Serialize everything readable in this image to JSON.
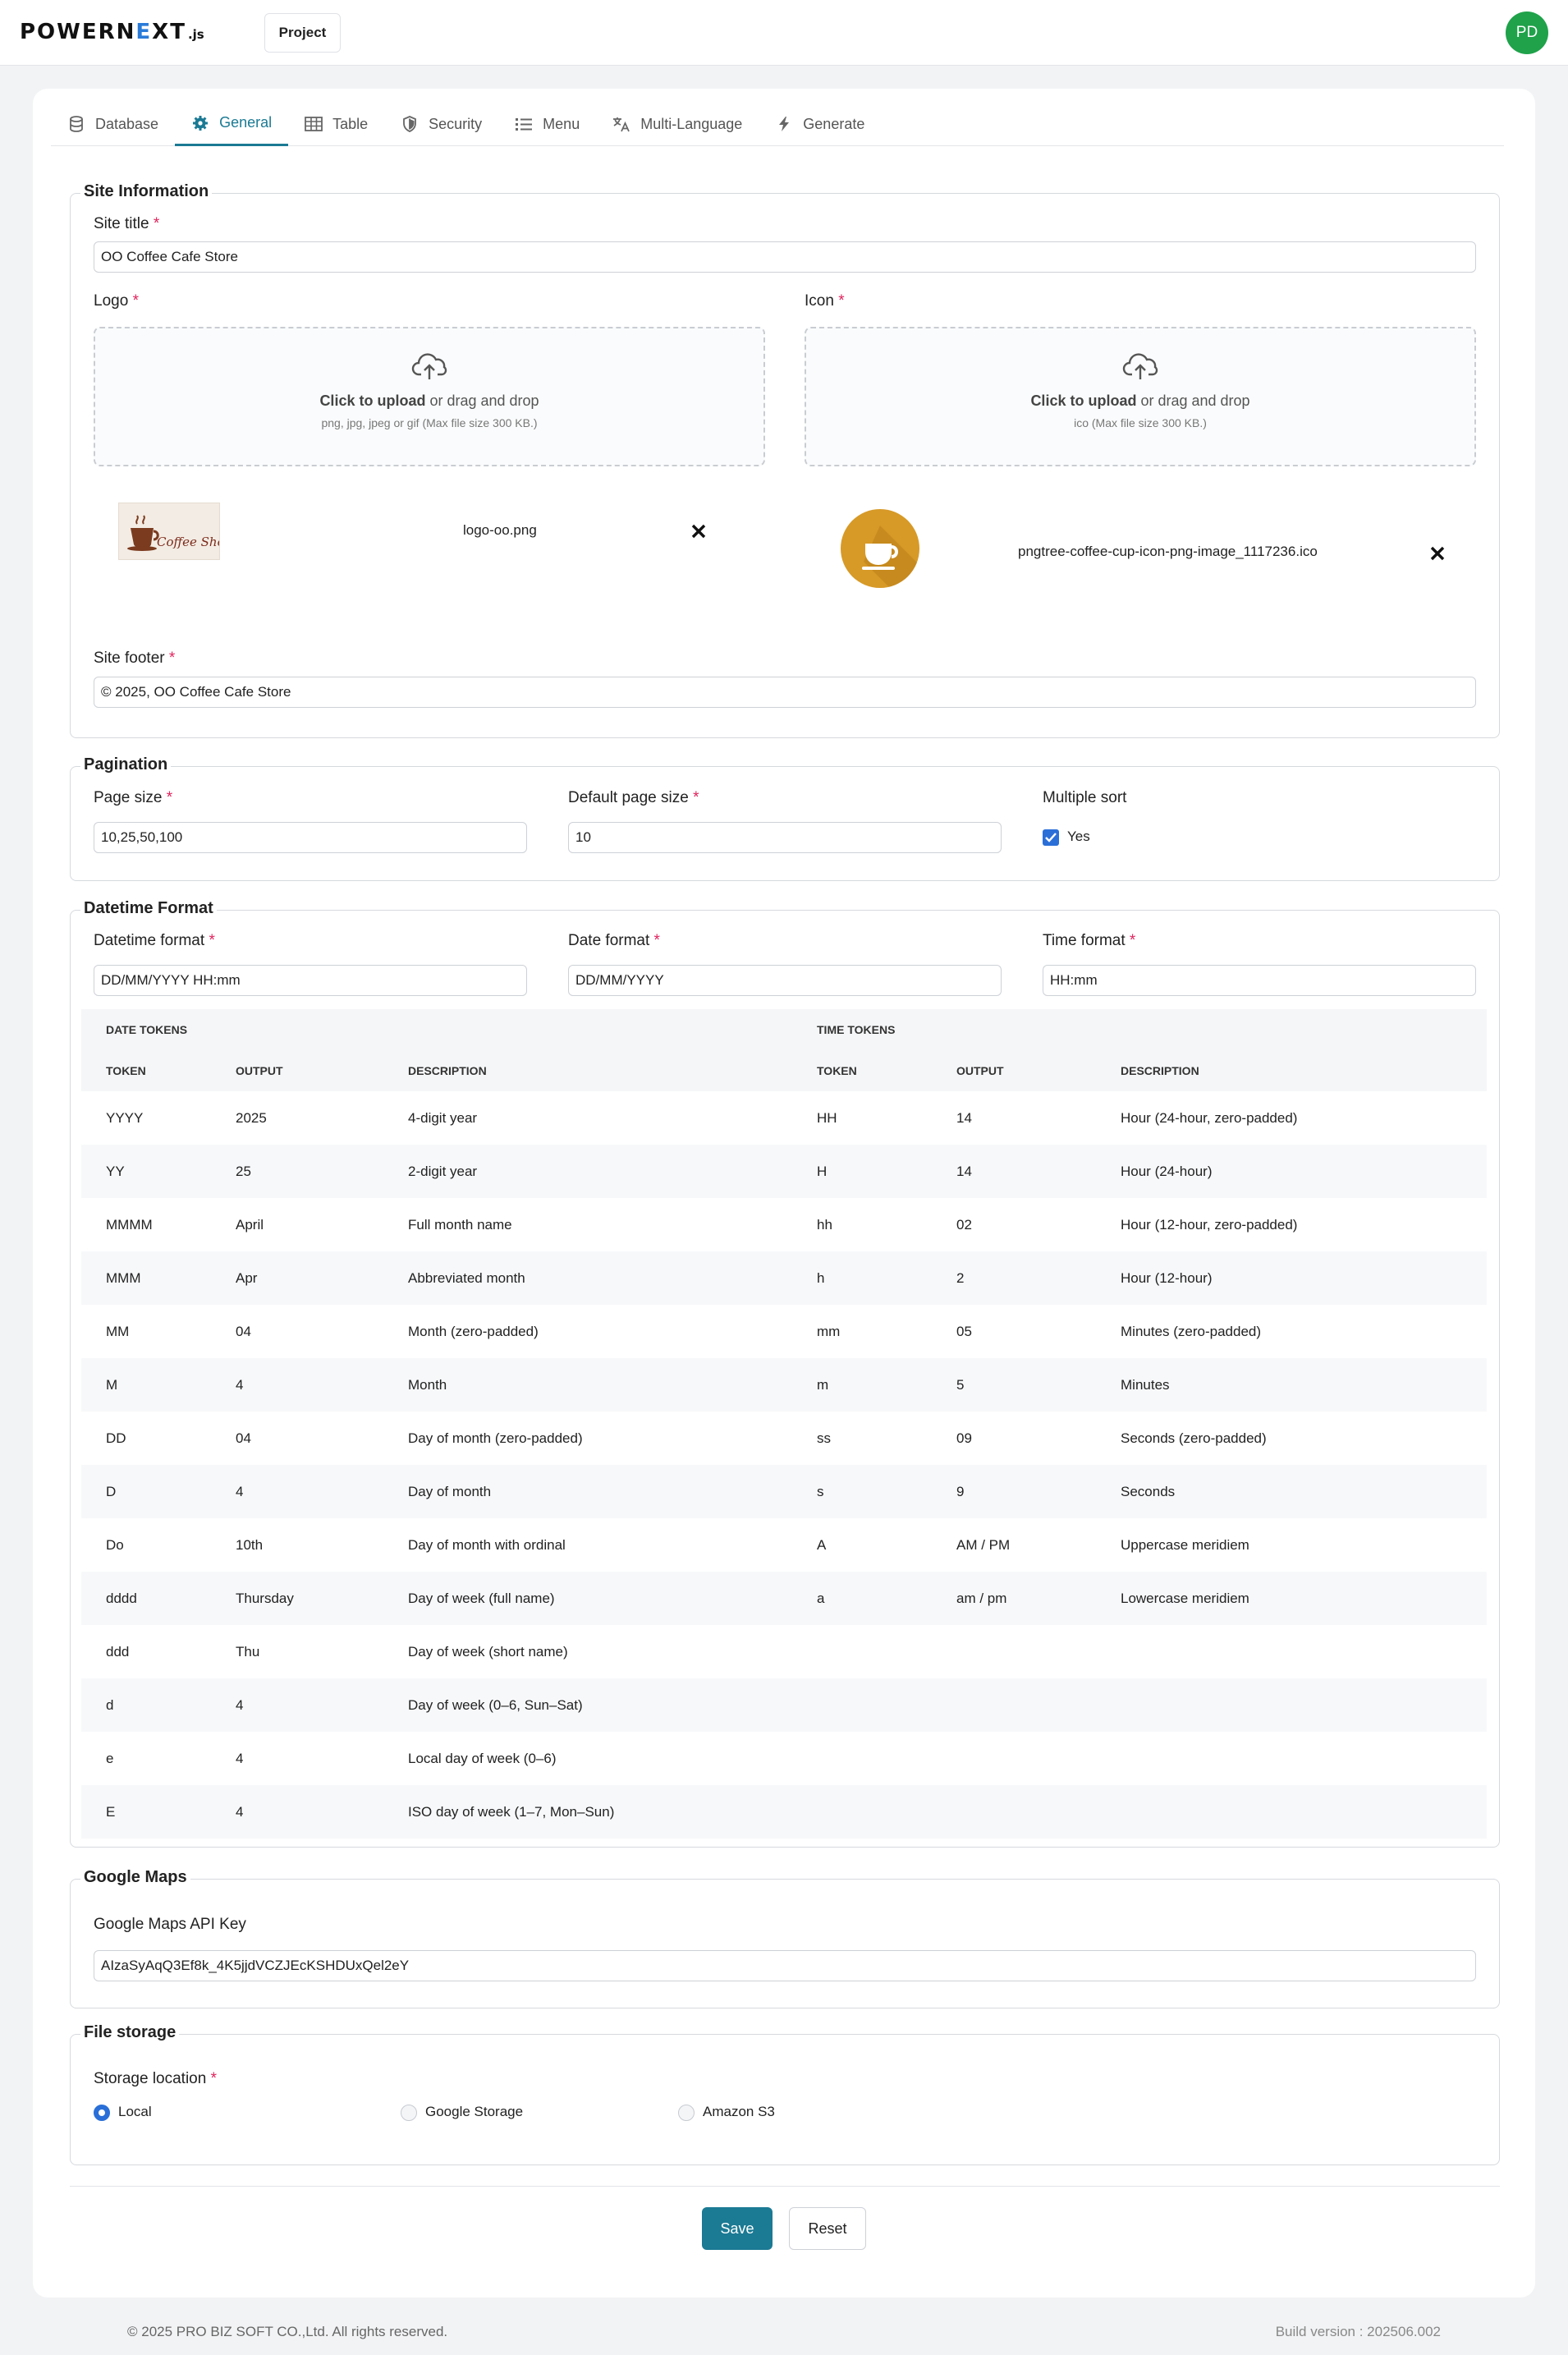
{
  "header": {
    "brand_prefix": "POWERN",
    "brand_highlight": "E",
    "brand_suffix": "XT",
    "brand_js": ".js",
    "project_label": "Project",
    "avatar_initials": "PD"
  },
  "tabs": [
    {
      "label": "Database",
      "icon": "database-icon"
    },
    {
      "label": "General",
      "icon": "gear-icon",
      "active": true
    },
    {
      "label": "Table",
      "icon": "table-icon"
    },
    {
      "label": "Security",
      "icon": "shield-icon"
    },
    {
      "label": "Menu",
      "icon": "list-icon"
    },
    {
      "label": "Multi-Language",
      "icon": "translate-icon"
    },
    {
      "label": "Generate",
      "icon": "lightning-icon"
    }
  ],
  "site_info": {
    "legend": "Site Information",
    "title_label": "Site title",
    "title_value": "OO Coffee Cafe Store",
    "logo_label": "Logo",
    "icon_label": "Icon",
    "upload_click": "Click to upload",
    "upload_rest": " or drag and drop",
    "logo_hint": "png, jpg, jpeg or gif (Max file size 300 KB.)",
    "icon_hint": "ico (Max file size 300 KB.)",
    "logo_image_text": "Coffee Shop",
    "logo_file": "logo-oo.png",
    "icon_file": "pngtree-coffee-cup-icon-png-image_1117236.ico",
    "footer_label": "Site footer",
    "footer_value": "© 2025, OO Coffee Cafe Store",
    "required_mark": "*"
  },
  "pagination": {
    "legend": "Pagination",
    "page_size_label": "Page size",
    "page_size_value": "10,25,50,100",
    "default_label": "Default page size",
    "default_value": "10",
    "multisort_label": "Multiple sort",
    "multisort_option": "Yes",
    "multisort_checked": true
  },
  "datetime": {
    "legend": "Datetime Format",
    "datetime_label": "Datetime format",
    "datetime_value": "DD/MM/YYYY HH:mm",
    "date_label": "Date format",
    "date_value": "DD/MM/YYYY",
    "time_label": "Time format",
    "time_value": "HH:mm",
    "date_tokens_title": "DATE TOKENS",
    "time_tokens_title": "TIME TOKENS",
    "columns": [
      "TOKEN",
      "OUTPUT",
      "DESCRIPTION"
    ],
    "date_tokens": [
      [
        "YYYY",
        "2025",
        "4-digit year"
      ],
      [
        "YY",
        "25",
        "2-digit year"
      ],
      [
        "MMMM",
        "April",
        "Full month name"
      ],
      [
        "MMM",
        "Apr",
        "Abbreviated month"
      ],
      [
        "MM",
        "04",
        "Month (zero-padded)"
      ],
      [
        "M",
        "4",
        "Month"
      ],
      [
        "DD",
        "04",
        "Day of month (zero-padded)"
      ],
      [
        "D",
        "4",
        "Day of month"
      ],
      [
        "Do",
        "10th",
        "Day of month with ordinal"
      ],
      [
        "dddd",
        "Thursday",
        "Day of week (full name)"
      ],
      [
        "ddd",
        "Thu",
        "Day of week (short name)"
      ],
      [
        "d",
        "4",
        "Day of week (0–6, Sun–Sat)"
      ],
      [
        "e",
        "4",
        "Local day of week (0–6)"
      ],
      [
        "E",
        "4",
        "ISO day of week (1–7, Mon–Sun)"
      ]
    ],
    "time_tokens": [
      [
        "HH",
        "14",
        "Hour (24-hour, zero-padded)"
      ],
      [
        "H",
        "14",
        "Hour (24-hour)"
      ],
      [
        "hh",
        "02",
        "Hour (12-hour, zero-padded)"
      ],
      [
        "h",
        "2",
        "Hour (12-hour)"
      ],
      [
        "mm",
        "05",
        "Minutes (zero-padded)"
      ],
      [
        "m",
        "5",
        "Minutes"
      ],
      [
        "ss",
        "09",
        "Seconds (zero-padded)"
      ],
      [
        "s",
        "9",
        "Seconds"
      ],
      [
        "A",
        "AM / PM",
        "Uppercase meridiem"
      ],
      [
        "a",
        "am / pm",
        "Lowercase meridiem"
      ]
    ]
  },
  "google_maps": {
    "legend": "Google Maps",
    "api_key_label": "Google Maps API Key",
    "api_key_value": "AIzaSyAqQ3Ef8k_4K5jjdVCZJEcKSHDUxQel2eY"
  },
  "file_storage": {
    "legend": "File storage",
    "location_label": "Storage location",
    "options": [
      {
        "label": "Local",
        "selected": true
      },
      {
        "label": "Google Storage",
        "selected": false
      },
      {
        "label": "Amazon S3",
        "selected": false
      }
    ]
  },
  "actions": {
    "save_label": "Save",
    "reset_label": "Reset"
  },
  "footer": {
    "copyright": "© 2025 PRO BIZ SOFT CO.,Ltd. All rights reserved.",
    "build": "Build version : 202506.002"
  },
  "colors": {
    "accent": "#1b7a94",
    "primary_blue": "#2a6fd8",
    "avatar": "#1fa24a",
    "required": "#e0245e"
  }
}
